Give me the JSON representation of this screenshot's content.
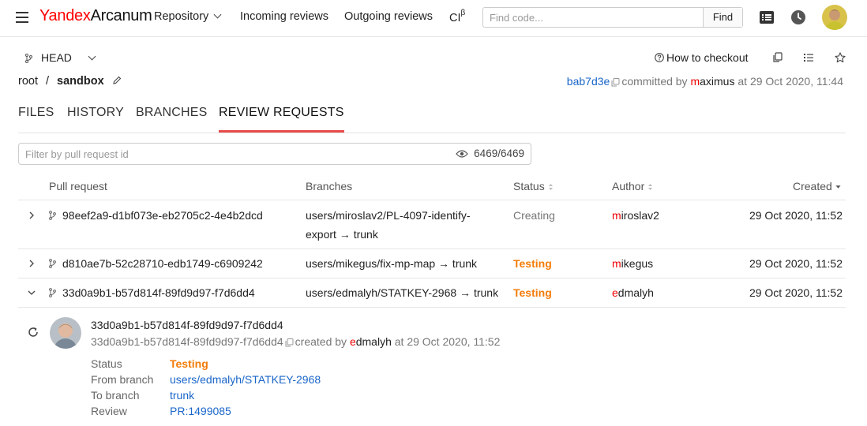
{
  "header": {
    "logo_brand": "Yandex",
    "logo_product": "Arcanum",
    "nav": [
      "Repository",
      "Incoming reviews",
      "Outgoing reviews"
    ],
    "ci_label": "CI",
    "ci_sup": "β",
    "search_placeholder": "Find code...",
    "find_label": "Find",
    "icons": [
      "menu-icon",
      "list-icon",
      "clock-icon",
      "avatar"
    ]
  },
  "subheader": {
    "branch": "HEAD",
    "howto": "How to checkout",
    "breadcrumb": [
      "root",
      "sandbox"
    ],
    "commit_hash": "bab7d3e",
    "committed_by": "committed by",
    "committer_first": "m",
    "committer_rest": "aximus",
    "commit_time": "at 29 Oct 2020, 11:44"
  },
  "tabs": [
    "FILES",
    "HISTORY",
    "BRANCHES",
    "REVIEW REQUESTS"
  ],
  "active_tab": "REVIEW REQUESTS",
  "filter": {
    "placeholder": "Filter by pull request id",
    "count": "6469/6469"
  },
  "table": {
    "columns": [
      "Pull request",
      "Branches",
      "Status",
      "Author",
      "Created"
    ],
    "rows": [
      {
        "id": "98eef2a9-d1bf073e-eb2705c2-4e4b2dcd",
        "branches": "users/miroslav2/PL-4097-identify-export → trunk",
        "status": "Creating",
        "author_first": "m",
        "author_rest": "iroslav2",
        "created": "29 Oct 2020, 11:52"
      },
      {
        "id": "d810ae7b-52c28710-edb1749-c6909242",
        "branches": "users/mikegus/fix-mp-map → trunk",
        "status": "Testing",
        "author_first": "m",
        "author_rest": "ikegus",
        "created": "29 Oct 2020, 11:52"
      },
      {
        "id": "33d0a9b1-b57d814f-89fd9d97-f7d6dd4",
        "branches": "users/edmalyh/STATKEY-2968 → trunk",
        "status": "Testing",
        "author_first": "e",
        "author_rest": "dmalyh",
        "created": "29 Oct 2020, 11:52"
      }
    ]
  },
  "details": {
    "title": "33d0a9b1-b57d814f-89fd9d97-f7d6dd4",
    "sub_id": "33d0a9b1-b57d814f-89fd9d97-f7d6dd4",
    "created_by": "created by",
    "author_first": "e",
    "author_rest": "dmalyh",
    "created_at": "at 29 Oct 2020, 11:52",
    "status_label": "Status",
    "status": "Testing",
    "from_label": "From branch",
    "from": "users/edmalyh/STATKEY-2968",
    "to_label": "To branch",
    "to": "trunk",
    "review_label": "Review",
    "review": "PR:1499085"
  },
  "colors": {
    "accent_red": "#e84a4a",
    "link_blue": "#1a66c9",
    "status_testing": "#f37c0a",
    "status_creating": "#777777"
  }
}
